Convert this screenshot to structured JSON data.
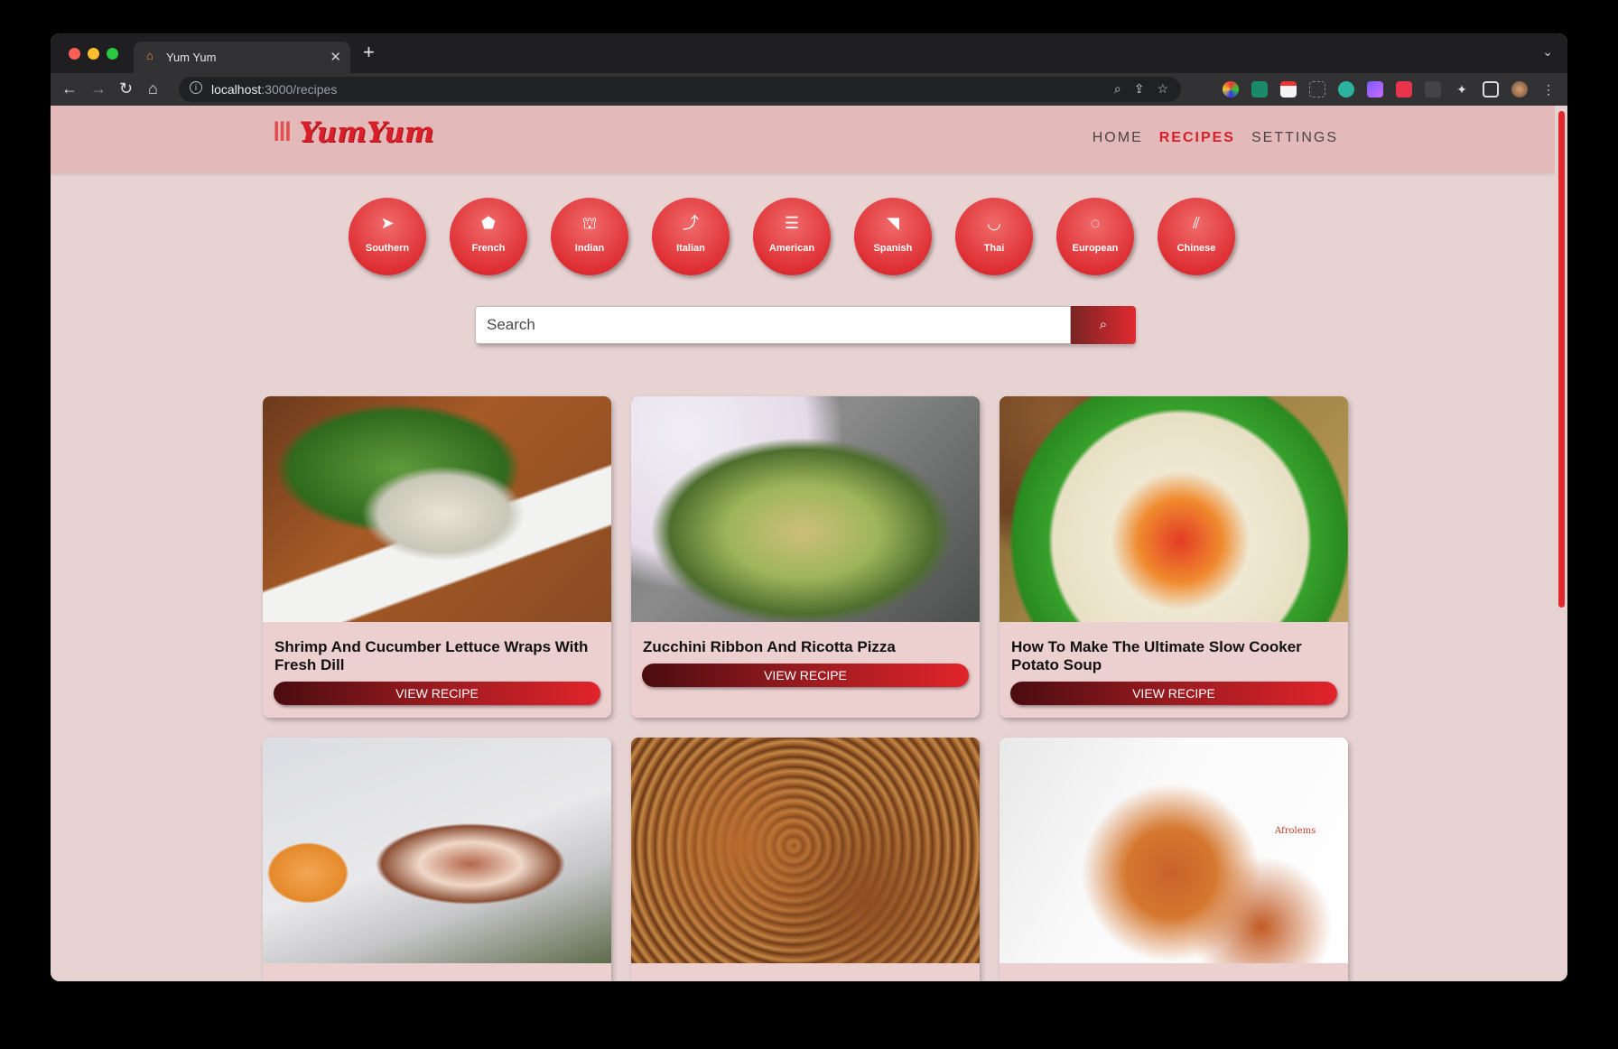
{
  "browser": {
    "tab_title": "Yum Yum",
    "url_host": "localhost",
    "url_path": ":3000/recipes"
  },
  "site": {
    "logo": "YumYum",
    "nav": [
      "HOME",
      "RECIPES",
      "SETTINGS"
    ],
    "nav_active": "RECIPES",
    "accent_color": "#d61f28"
  },
  "cuisines": [
    {
      "label": "Southern",
      "icon": "map-pin-icon"
    },
    {
      "label": "French",
      "icon": "france-icon"
    },
    {
      "label": "Indian",
      "icon": "taj-mahal-icon"
    },
    {
      "label": "Italian",
      "icon": "italy-icon"
    },
    {
      "label": "American",
      "icon": "us-flag-icon"
    },
    {
      "label": "Spanish",
      "icon": "spain-icon"
    },
    {
      "label": "Thai",
      "icon": "noodle-bowl-icon"
    },
    {
      "label": "European",
      "icon": "eu-stars-icon"
    },
    {
      "label": "Chinese",
      "icon": "chopsticks-icon"
    }
  ],
  "search": {
    "placeholder": "Search"
  },
  "recipes": [
    {
      "title": "Shrimp And Cucumber Lettuce Wraps With Fresh Dill",
      "button": "VIEW RECIPE"
    },
    {
      "title": "Zucchini Ribbon And Ricotta Pizza",
      "button": "VIEW RECIPE"
    },
    {
      "title": "How To Make The Ultimate Slow Cooker Potato Soup",
      "button": "VIEW RECIPE"
    },
    {
      "title": "",
      "button": ""
    },
    {
      "title": "",
      "button": ""
    },
    {
      "title": "",
      "button": "",
      "image_text": "Afrolems"
    }
  ]
}
